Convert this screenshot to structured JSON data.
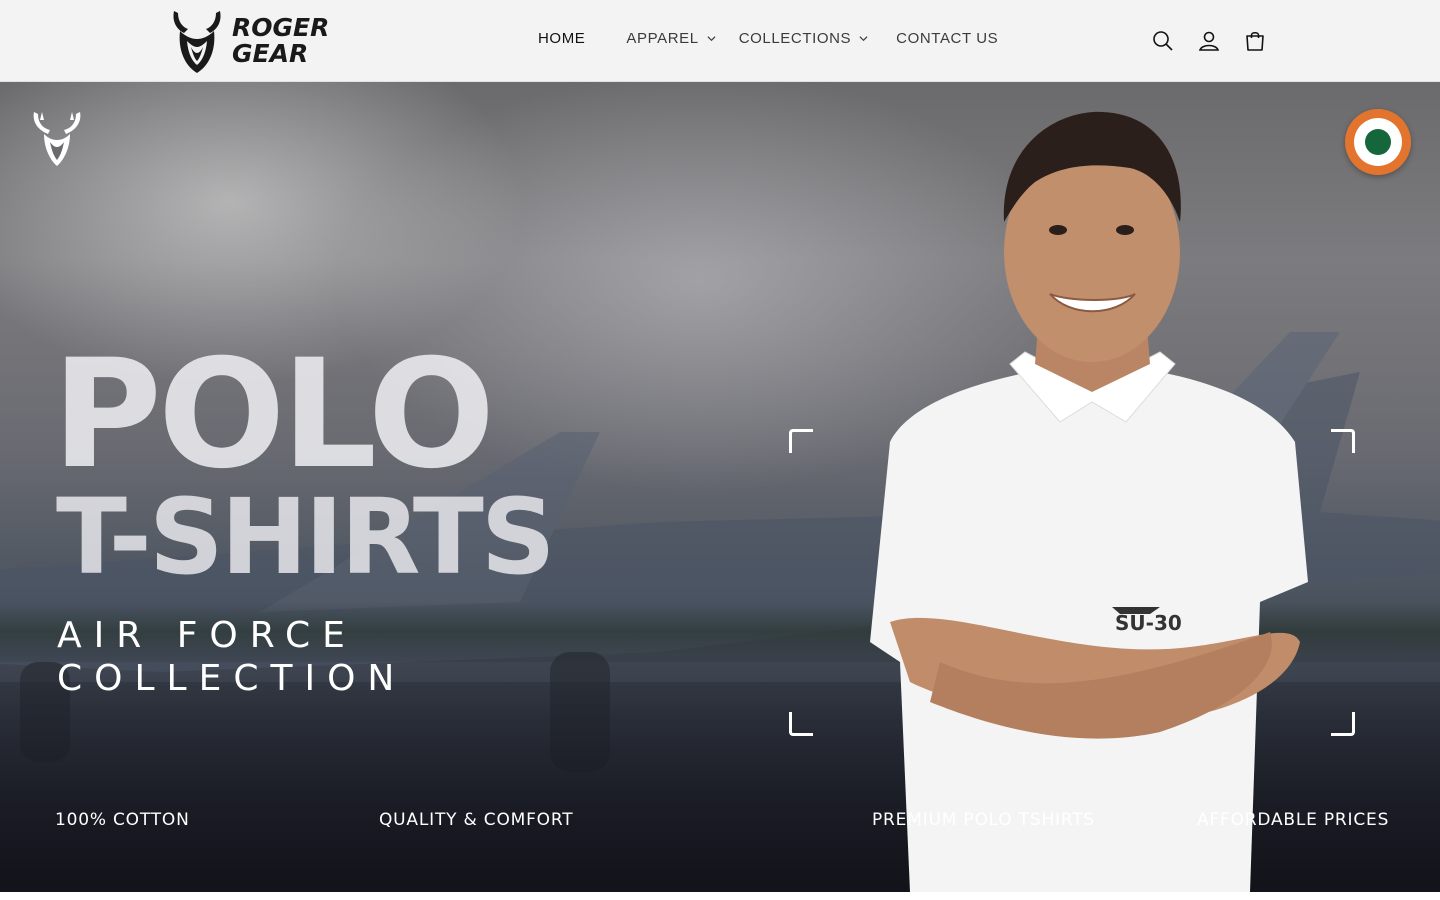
{
  "brand": {
    "name_line1": "ROGER",
    "name_line2": "GEAR"
  },
  "nav": {
    "items": [
      {
        "label": "HOME",
        "has_dropdown": false,
        "active": true
      },
      {
        "label": "APPAREL",
        "has_dropdown": true,
        "active": false
      },
      {
        "label": "COLLECTIONS",
        "has_dropdown": true,
        "active": false
      },
      {
        "label": "CONTACT US",
        "has_dropdown": false,
        "active": false
      }
    ]
  },
  "header_icons": [
    "search-icon",
    "account-icon",
    "cart-icon"
  ],
  "hero": {
    "title_line1": "POLO",
    "title_line2": "T-SHIRTS",
    "subtitle_line1": "AIR FORCE",
    "subtitle_line2": "COLLECTION",
    "features": [
      "100% COTTON",
      "QUALITY & COMFORT",
      "PREMIUM POLO TSHIRTS",
      "AFFORDABLE PRICES"
    ],
    "shirt_badge": "SU-30"
  },
  "colors": {
    "header_bg": "#f3f3f3",
    "roundel_saffron": "#e3742e",
    "roundel_white": "#ffffff",
    "roundel_green": "#15663a",
    "hero_text": "#ffffff"
  }
}
